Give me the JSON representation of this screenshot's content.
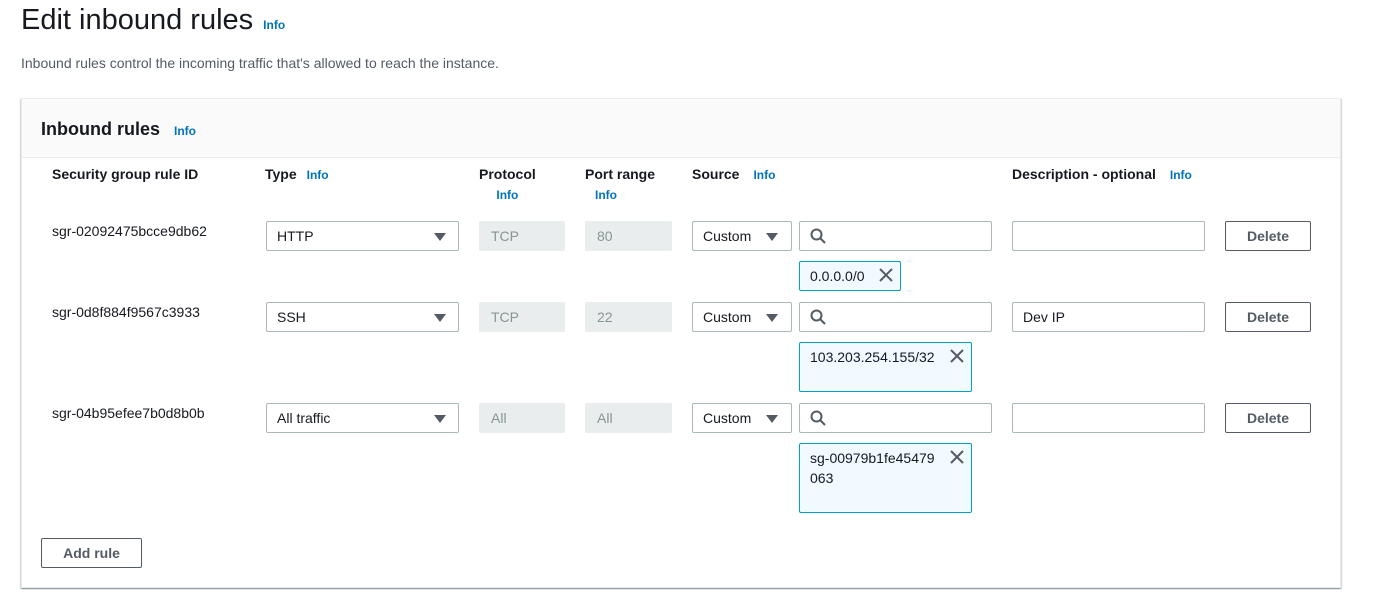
{
  "page": {
    "title": "Edit inbound rules",
    "title_info": "Info",
    "description": "Inbound rules control the incoming traffic that's allowed to reach the instance."
  },
  "panel": {
    "title": "Inbound rules",
    "title_info": "Info",
    "columns": {
      "rule_id": "Security group rule ID",
      "type": "Type",
      "type_info": "Info",
      "protocol": "Protocol",
      "protocol_info": "Info",
      "port_range": "Port range",
      "port_range_info": "Info",
      "source": "Source",
      "source_info": "Info",
      "description": "Description - optional",
      "description_info": "Info"
    },
    "rules": [
      {
        "id": "sgr-02092475bcce9db62",
        "type": "HTTP",
        "protocol": "TCP",
        "port": "80",
        "source_mode": "Custom",
        "source_value": "0.0.0.0/0",
        "description": "",
        "delete_label": "Delete"
      },
      {
        "id": "sgr-0d8f884f9567c3933",
        "type": "SSH",
        "protocol": "TCP",
        "port": "22",
        "source_mode": "Custom",
        "source_value": "103.203.254.155/32",
        "description": "Dev IP",
        "delete_label": "Delete"
      },
      {
        "id": "sgr-04b95efee7b0d8b0b",
        "type": "All traffic",
        "protocol": "All",
        "port": "All",
        "source_mode": "Custom",
        "source_value": "sg-00979b1fe45479063",
        "description": "",
        "delete_label": "Delete"
      }
    ],
    "add_rule_label": "Add rule"
  },
  "icons": {
    "dropdown": "chevron-down-icon",
    "search": "search-icon",
    "remove": "close-icon"
  },
  "colors": {
    "link": "#0073bb",
    "token_bg": "#f1faff",
    "token_border": "#00a1c9",
    "disabled_bg": "#eaeded"
  }
}
